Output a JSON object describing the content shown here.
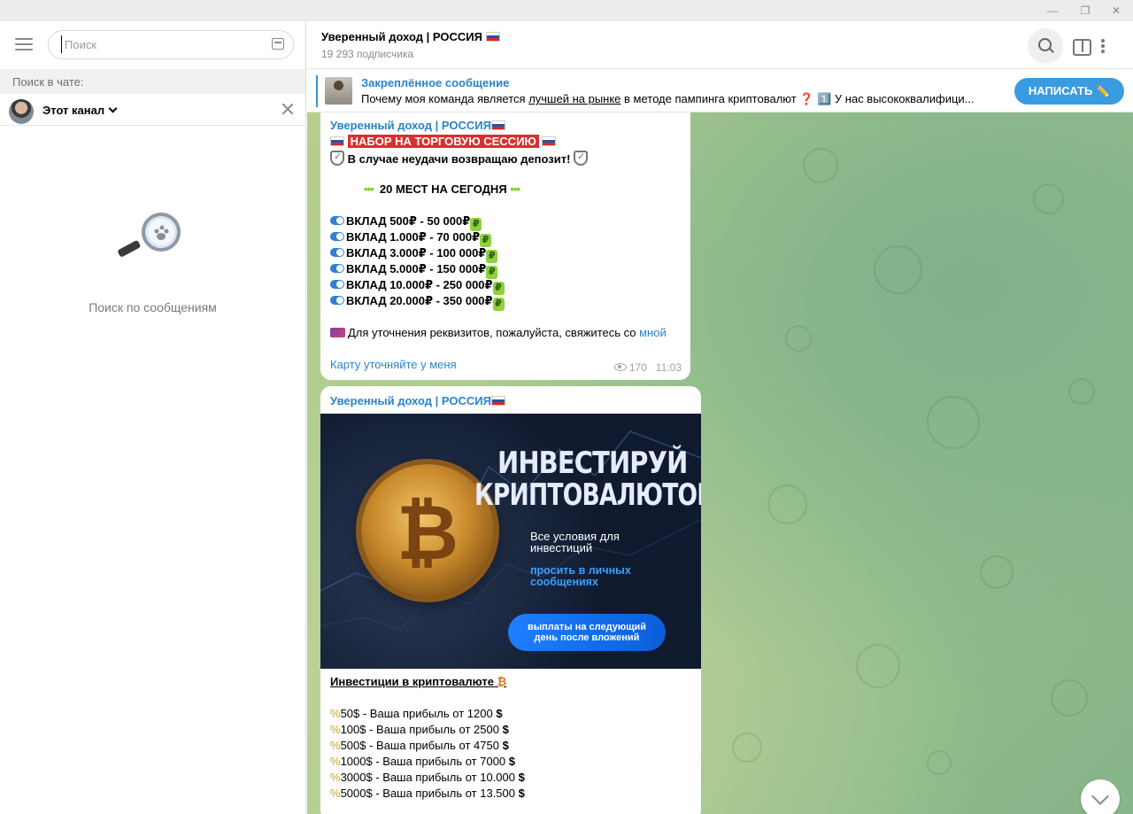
{
  "sidebar": {
    "search_placeholder": "Поиск",
    "search_in_label": "Поиск в чате:",
    "scope_label": "Этот канал",
    "empty_label": "Поиск по сообщениям"
  },
  "header": {
    "title": "Уверенный доход | РОССИЯ",
    "subscribers": "19 293 подписчика"
  },
  "pinned": {
    "title": "Закреплённое сообщение",
    "text_before": "Почему моя команда является ",
    "text_link": "лучшей на рынке",
    "text_after": " в методе пампинга криптовалют ❓ 1️⃣ У нас высококвалифици...",
    "button": "НАПИСАТЬ ✏️"
  },
  "post1": {
    "channel": "Уверенный доход | РОССИЯ",
    "headline": "НАБОР НА ТОРГОВУЮ СЕССИЮ",
    "guarantee": "В случае неудачи возвращаю депозит!",
    "seats": "20 МЕСТ НА СЕГОДНЯ",
    "deposits": [
      "ВКЛАД 500₽ - 50 000₽",
      "ВКЛАД 1.000₽ - 70 000₽",
      "ВКЛАД 3.000₽ - 100 000₽",
      "ВКЛАД 5.000₽ - 150 000₽",
      "ВКЛАД 10.000₽ - 250 000₽",
      "ВКЛАД 20.000₽ - 350 000₽"
    ],
    "contact_text": "Для уточнения реквизитов, пожалуйста, свяжитесь со ",
    "contact_link": "мной",
    "card_link": "Карту уточняйте у меня",
    "views": "170",
    "time": "11:03"
  },
  "post2": {
    "channel": "Уверенный доход | РОССИЯ",
    "banner": {
      "line1": "ИНВЕСТИРУЙ",
      "line2": "КРИПТОВАЛЮТОЙ",
      "text1a": "Все условия для",
      "text1b": "инвестиций",
      "text2a": "просить в личных",
      "text2b": "сообщениях",
      "pill_a": "выплаты на следующий",
      "pill_b": "день после вложений"
    },
    "heading": "Инвестиции в криптовалюте",
    "rows": [
      "50$ - Ваша прибыль от 1200",
      "100$ - Ваша прибыль от 2500",
      "500$ - Ваша прибыль от 4750",
      "1000$ - Ваша прибыль от 7000",
      "3000$ - Ваша прибыль от 10.000",
      "5000$ - Ваша прибыль от 13.500"
    ]
  },
  "colors": {
    "accent": "#2a83c9",
    "button": "#3a9be0",
    "headline_bg": "#d83030"
  }
}
